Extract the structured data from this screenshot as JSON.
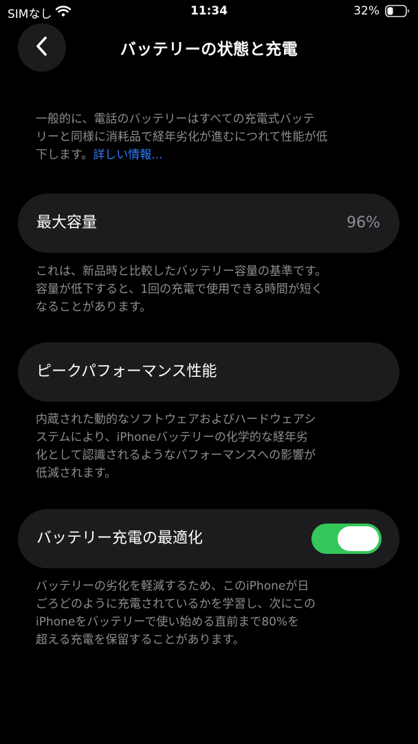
{
  "status": {
    "carrier": "SIMなし",
    "time": "11:34",
    "battery_percent": "32%",
    "battery_level": 0.32
  },
  "nav": {
    "title": "バッテリーの状態と充電",
    "back_icon": "chevron-left-icon"
  },
  "intro": {
    "text": "一般的に、電話のバッテリーはすべての充電式バッテ\nリーと同様に消耗品で経年劣化が進むにつれて性能が低\n下します。",
    "link": "詳しい情報..."
  },
  "max_capacity": {
    "label": "最大容量",
    "value": "96%",
    "description": "これは、新品時と比較したバッテリー容量の基準です。\n容量が低下すると、1回の充電で使用できる時間が短く\nなることがあります。"
  },
  "peak_performance": {
    "label": "ピークパフォーマンス性能",
    "description": "内蔵された動的なソフトウェアおよびハードウェアシ\nステムにより、iPhoneバッテリーの化学的な経年劣\n化として認識されるようなパフォーマンスへの影響が\n低減されます。"
  },
  "optimized_charging": {
    "label": "バッテリー充電の最適化",
    "enabled": true,
    "description": "バッテリーの劣化を軽減するため、このiPhoneが日\nごろどのように充電されているかを学習し、次にこの\niPhoneをバッテリーで使い始める直前まで80%を\n超える充電を保留することがあります。"
  },
  "colors": {
    "background": "#000000",
    "cell": "#1c1c1e",
    "secondary_text": "#8e8e93",
    "link": "#2f7df6",
    "toggle_on": "#34c759"
  }
}
